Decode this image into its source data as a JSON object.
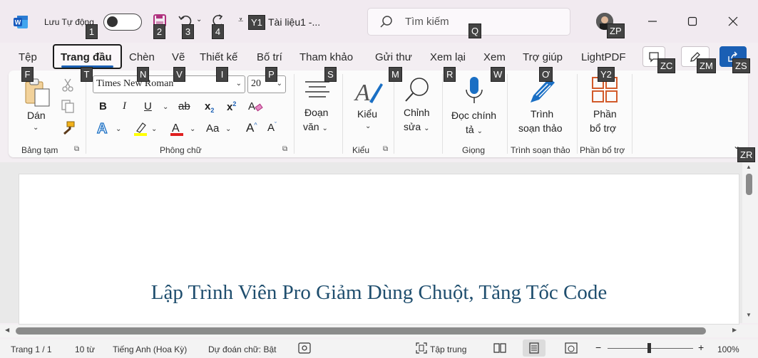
{
  "titlebar": {
    "autosave_label": "Lưu Tự động",
    "doc_title": "Tài liệu1  -...",
    "search_placeholder": "Tìm kiếm"
  },
  "tabs": {
    "file": "Tệp",
    "home": "Trang đầu",
    "insert": "Chèn",
    "draw": "Vẽ",
    "design": "Thiết kế",
    "layout": "Bố trí",
    "references": "Tham khảo",
    "mailings": "Gửi thư",
    "review": "Xem lại",
    "view": "Xem",
    "help": "Trợ giúp",
    "lightpdf": "LightPDF"
  },
  "keytips": {
    "autosave": "1",
    "save": "2",
    "undo": "3",
    "redo": "4",
    "customize": "Y1",
    "search": "Q",
    "account": "ZP",
    "file": "F",
    "home": "T",
    "insert": "N",
    "draw": "V",
    "design": "I",
    "layout": "P",
    "references": "S",
    "mailings": "M",
    "review": "R",
    "view": "W",
    "help": "Ơ",
    "lightpdf": "Y2",
    "comments": "ZC",
    "editing": "ZM",
    "share": "ZS",
    "collapse": "ZR"
  },
  "ribbon": {
    "paste_label": "Dán",
    "clipboard_group": "Bảng tạm",
    "font_name": "Times New Roman",
    "font_size": "20",
    "font_group": "Phông chữ",
    "bold": "B",
    "italic": "I",
    "underline": "U",
    "strike": "ab",
    "change_case": "Aa",
    "paragraph_label_1": "Đoạn",
    "paragraph_label_2": "văn",
    "styles_label": "Kiểu",
    "styles_group": "Kiểu",
    "editing_label_1": "Chỉnh",
    "editing_label_2": "sửa",
    "dictate_label_1": "Đọc chính",
    "dictate_label_2": "tả",
    "voice_group": "Giọng",
    "editor_label_1": "Trình",
    "editor_label_2": "soạn thảo",
    "editor_group": "Trình soạn thảo",
    "addins_label_1": "Phần",
    "addins_label_2": "bổ trợ",
    "addins_group": "Phần bổ trợ"
  },
  "document": {
    "heading": "Lập Trình Viên Pro Giảm Dùng Chuột, Tăng Tốc Code"
  },
  "statusbar": {
    "page": "Trang 1 / 1",
    "words": "10 từ",
    "language": "Tiếng Anh (Hoa Kỳ)",
    "prediction": "Dự đoán chữ: Bật",
    "focus": "Tập trung",
    "zoom": "100%"
  },
  "colors": {
    "accent": "#1a5fb4",
    "heading": "#1f4e6e",
    "keytip_bg": "#444444",
    "save_icon": "#b0317e",
    "highlight": "#ffff00",
    "font_color": "#e02020"
  }
}
